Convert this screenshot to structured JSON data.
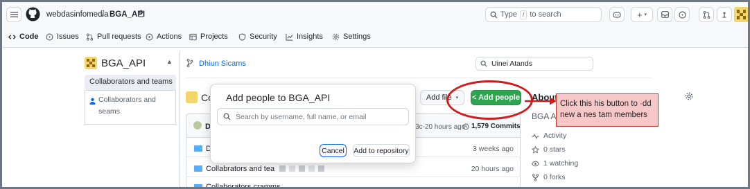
{
  "header": {
    "owner": "webdasinfomedia",
    "separator": "/",
    "repo": "BGA_API",
    "search_placeholder_prefix": "Type",
    "search_key": "/",
    "search_placeholder_suffix": "to search"
  },
  "repo_nav": {
    "items": [
      {
        "label": "Code",
        "icon": "code-icon"
      },
      {
        "label": "Issues",
        "icon": "issue-icon"
      },
      {
        "label": "Pull requests",
        "icon": "pull-request-icon"
      },
      {
        "label": "Actions",
        "icon": "play-icon"
      },
      {
        "label": "Projects",
        "icon": "table-icon"
      },
      {
        "label": "Security",
        "icon": "shield-icon"
      },
      {
        "label": "Insights",
        "icon": "graph-icon"
      },
      {
        "label": "Settings",
        "icon": "gear-icon"
      }
    ]
  },
  "sidebar": {
    "repo_name": "BGA_API",
    "selected": "Collaborators and teams",
    "sub_item_line1": "Collaborators and",
    "sub_item_line2": "seams"
  },
  "main": {
    "branch_label": "Dhiun Sicams",
    "search_value": "Uinei Atands",
    "title_prefix": "Co",
    "add_file_label": "Add file",
    "add_people_label": "< Add people",
    "commit_row_letter": "D",
    "commit_time": "3c-20 hours ago",
    "commit_count": "1,579 Commits",
    "files": [
      {
        "name": "D",
        "time": "3 weeks ago"
      },
      {
        "name": "Collabrators and tea",
        "time": "20 hours ago"
      },
      {
        "name": "Collaborators cramms",
        "time": ""
      }
    ]
  },
  "modal": {
    "title": "Add people to BGA_API",
    "search_placeholder": "Search by username, full name, or email",
    "cancel_label": "Cancel",
    "add_label": "Add to repository"
  },
  "about": {
    "heading": "About",
    "description": "BGA A",
    "activity": "Activity",
    "stars": "0 stars",
    "watching": "1 watching",
    "forks": "0 forks"
  },
  "annotation": {
    "line1": "Click this his button to ·dd",
    "line2": "new a nes tam members"
  },
  "colors": {
    "accent_green": "#2da44e",
    "annotation_red": "#d01c1c",
    "annotation_fill": "#f7c6c6",
    "folder_blue": "#54aeff"
  }
}
